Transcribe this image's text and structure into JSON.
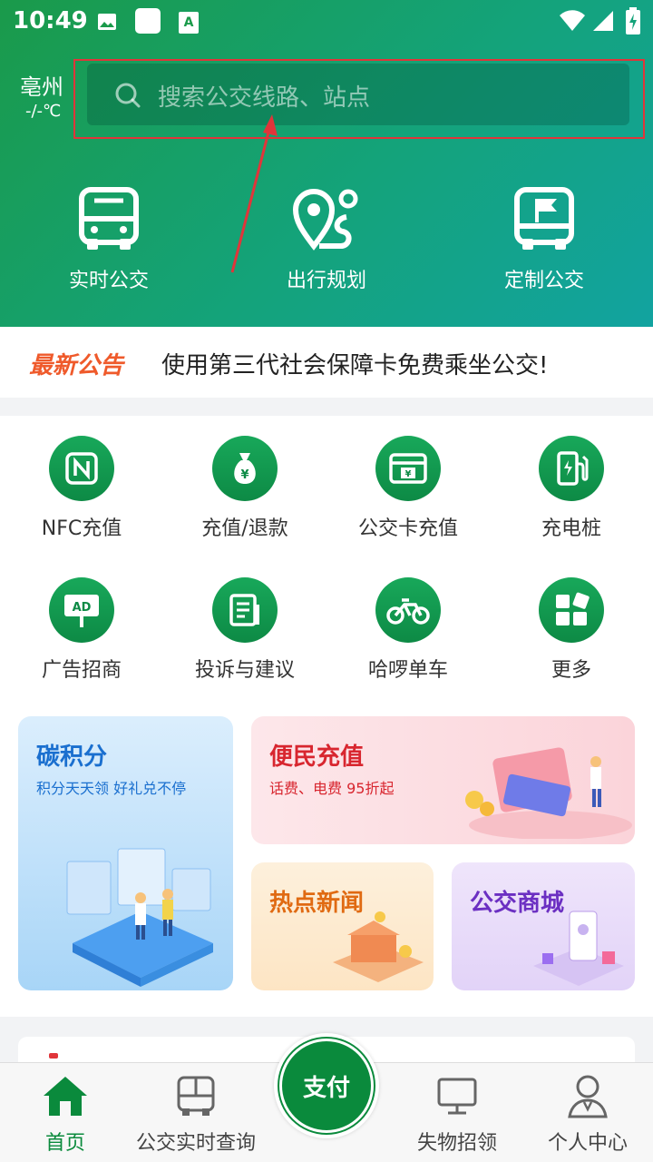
{
  "status_bar": {
    "time": "10:49"
  },
  "header": {
    "city": "亳州",
    "temperature": "-/-℃",
    "search_placeholder": "搜索公交线路、站点",
    "features": [
      {
        "label": "实时公交",
        "icon": "bus-icon"
      },
      {
        "label": "出行规划",
        "icon": "route-pin-icon"
      },
      {
        "label": "定制公交",
        "icon": "custom-bus-flag-icon"
      }
    ]
  },
  "notice": {
    "tag": "最新公告",
    "text": "使用第三代社会保障卡免费乘坐公交!"
  },
  "grid": [
    {
      "label": "NFC充值",
      "icon": "nfc-icon"
    },
    {
      "label": "充值/退款",
      "icon": "money-bag-icon"
    },
    {
      "label": "公交卡充值",
      "icon": "bus-card-icon"
    },
    {
      "label": "充电桩",
      "icon": "charging-pile-icon"
    },
    {
      "label": "广告招商",
      "icon": "ad-board-icon"
    },
    {
      "label": "投诉与建议",
      "icon": "document-icon"
    },
    {
      "label": "哈啰单车",
      "icon": "bicycle-icon"
    },
    {
      "label": "更多",
      "icon": "more-grid-icon"
    }
  ],
  "cards": {
    "carbon": {
      "title": "碳积分",
      "subtitle": "积分天天领 好礼兑不停"
    },
    "recharge": {
      "title": "便民充值",
      "subtitle": "话费、电费 95折起"
    },
    "news": {
      "title": "热点新闻"
    },
    "mall": {
      "title": "公交商城"
    }
  },
  "tabbar": {
    "home": "首页",
    "realtime": "公交实时查询",
    "pay": "支付",
    "lost": "失物招领",
    "profile": "个人中心"
  },
  "colors": {
    "header_start": "#1a9a4a",
    "header_end": "#12a3a0",
    "accent_green": "#0a8a3c",
    "notice_tag": "#ef5a2b",
    "annotation_red": "#e0353a"
  }
}
